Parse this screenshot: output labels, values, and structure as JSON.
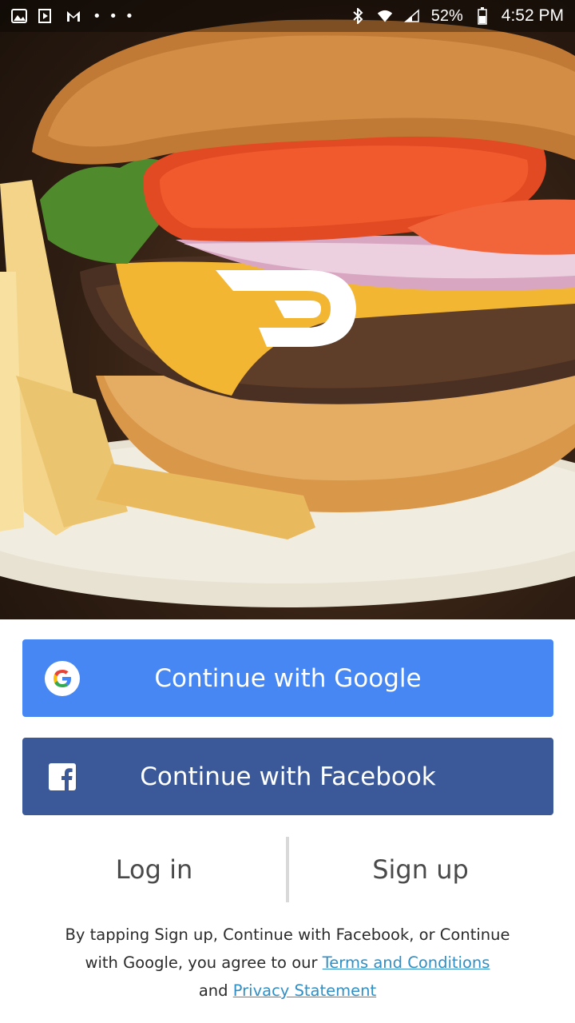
{
  "status_bar": {
    "left_icons": [
      "image-icon",
      "media-icon",
      "gmail-icon",
      "more-dots-icon"
    ],
    "more_label": "• • •",
    "battery": "52%",
    "time": "4:52 PM"
  },
  "hero": {
    "image": "burger-and-fries-photo",
    "logo": "doordash-logo"
  },
  "buttons": {
    "google_label": "Continue with Google",
    "facebook_label": "Continue with Facebook"
  },
  "auth_tabs": {
    "login_label": "Log in",
    "signup_label": "Sign up"
  },
  "legal": {
    "line1": "By tapping Sign up, Continue with Facebook, or Continue",
    "line2_prefix": "with Google, you agree to our ",
    "terms_link": "Terms and Conditions",
    "line3_prefix": "and ",
    "privacy_link": "Privacy Statement"
  },
  "colors": {
    "google_button": "#4787f3",
    "facebook_button": "#3b5998",
    "link": "#2f8fc6"
  }
}
